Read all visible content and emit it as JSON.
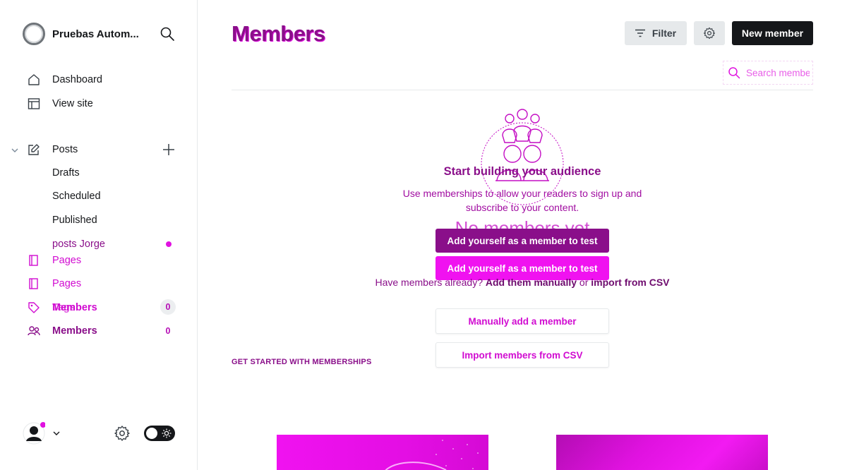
{
  "sidebar": {
    "site_name": "Pruebas Autom...",
    "nav": {
      "dashboard": "Dashboard",
      "view_site": "View site",
      "posts": "Posts",
      "drafts": "Drafts",
      "scheduled": "Scheduled",
      "published": "Published",
      "posts_jorge": "posts Jorge",
      "pages_1": "Pages",
      "pages_2": "Pages",
      "tags": "Tags",
      "members_overlay": "Members",
      "members_count_overlay": "0",
      "members": "Members",
      "members_count": "0"
    }
  },
  "header": {
    "title": "Members",
    "filter_label": "Filter",
    "new_member_label": "New member",
    "search_placeholder": "Search membe"
  },
  "empty_state": {
    "title": "Start building your audience",
    "description": "Use memberships to allow your readers to sign up and subscribe to your content.",
    "ghost_text": "No members yet",
    "self_add_label_1": "Add yourself as a member to test",
    "self_add_label_2": "Add yourself as a member to test",
    "have_members_prefix": "Have members already?",
    "add_manually_link": "Add them manually",
    "or_text": "or",
    "import_csv_link": "import from CSV",
    "manual_add_label": "Manually add a member",
    "import_label": "Import members from CSV"
  },
  "section": {
    "get_started": "GET STARTED WITH MEMBERSHIPS"
  },
  "colors": {
    "accent_purple": "#8a0f8a",
    "accent_magenta": "#f012f0",
    "primary_dark": "#15171a"
  }
}
